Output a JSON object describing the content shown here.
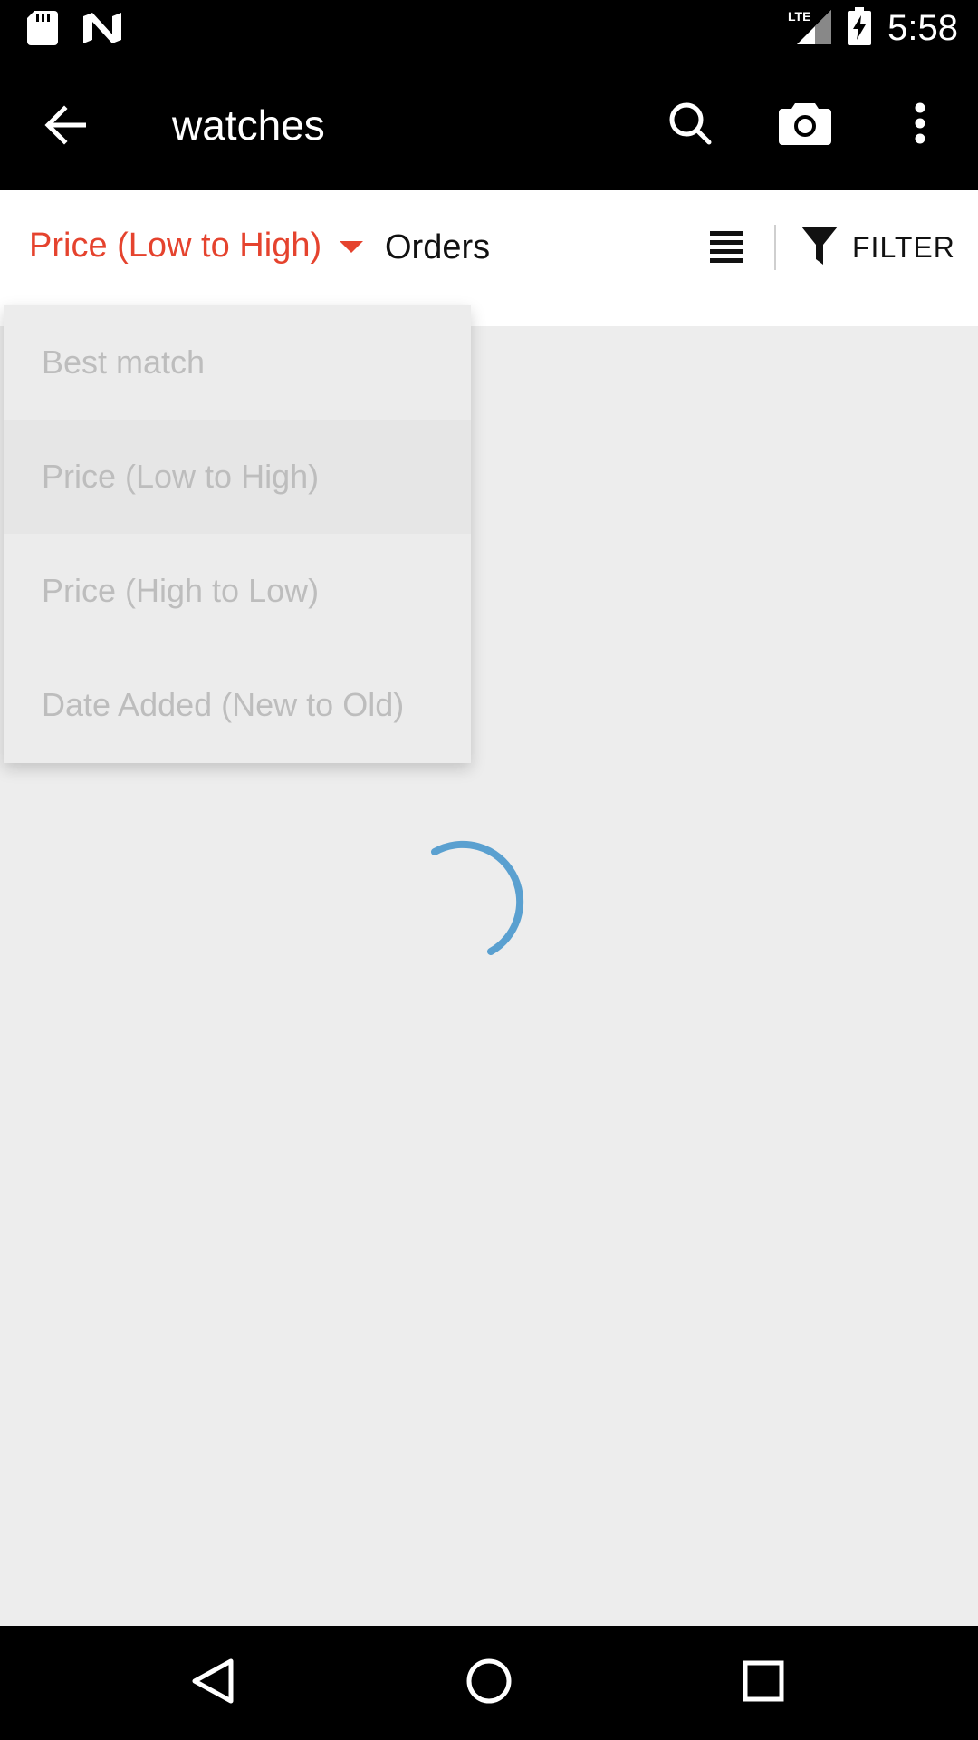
{
  "status_bar": {
    "time": "5:58",
    "network": "LTE",
    "left_icons": [
      "sd-card-icon",
      "notification-n-icon"
    ],
    "right_icons": [
      "lte-signal-icon",
      "battery-charging-icon"
    ]
  },
  "toolbar": {
    "title": "watches",
    "icons": [
      "back-arrow-icon",
      "search-icon",
      "camera-icon",
      "more-vert-icon"
    ]
  },
  "sort_bar": {
    "selected_sort": "Price (Low to High)",
    "orders_label": "Orders",
    "filter_label": "FILTER",
    "accent_color": "#e5432e"
  },
  "sort_menu": {
    "items": [
      {
        "label": "Best match"
      },
      {
        "label": "Price (Low to High)",
        "selected": true
      },
      {
        "label": "Price (High to Low)"
      },
      {
        "label": "Date Added (New to Old)"
      }
    ]
  },
  "loading": {
    "spinner_color": "#5aa0d0"
  },
  "nav_bar": {
    "icons": [
      "back-triangle-icon",
      "home-circle-icon",
      "recents-square-icon"
    ]
  }
}
